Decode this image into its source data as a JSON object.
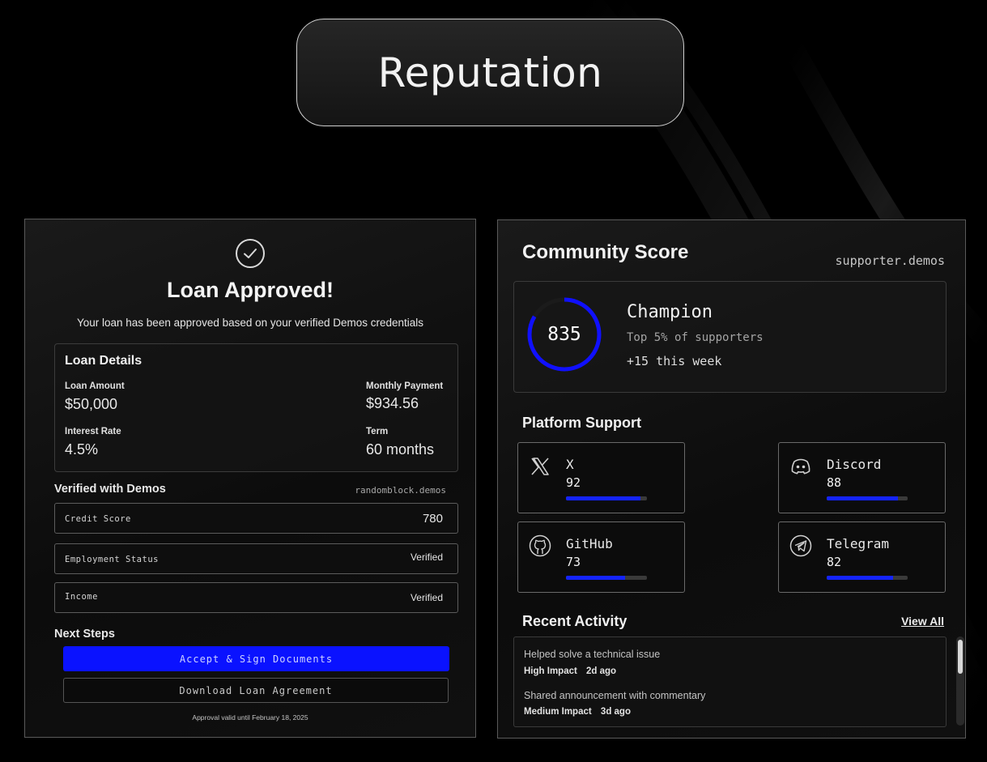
{
  "header": {
    "title": "Reputation"
  },
  "loan": {
    "title": "Loan Approved!",
    "subtitle": "Your loan has been approved based on your verified Demos credentials",
    "details": {
      "title": "Loan Details",
      "amount_label": "Loan Amount",
      "amount_value": "$50,000",
      "monthly_label": "Monthly Payment",
      "monthly_value": "$934.56",
      "rate_label": "Interest Rate",
      "rate_value": "4.5%",
      "term_label": "Term",
      "term_value": "60 months"
    },
    "verified": {
      "title": "Verified with Demos",
      "domain": "randomblock.demos",
      "rows": [
        {
          "label": "Credit Score",
          "value": "780"
        },
        {
          "label": "Employment Status",
          "value": "Verified"
        },
        {
          "label": "Income",
          "value": "Verified"
        }
      ]
    },
    "next_steps": {
      "title": "Next Steps",
      "primary_label": "Accept & Sign Documents",
      "secondary_label": "Download Loan Agreement"
    },
    "validity": "Approval valid until February 18, 2025"
  },
  "community": {
    "title": "Community Score",
    "domain": "supporter.demos",
    "score": {
      "value": "835",
      "ring_fraction": 0.835,
      "tier": "Champion",
      "rank": "Top 5% of supporters",
      "week": "+15 this week"
    },
    "platform_support": {
      "title": "Platform Support",
      "platforms": [
        {
          "name": "X",
          "score": "92",
          "icon": "x-logo-icon"
        },
        {
          "name": "Discord",
          "score": "88",
          "icon": "discord-icon"
        },
        {
          "name": "GitHub",
          "score": "73",
          "icon": "github-icon"
        },
        {
          "name": "Telegram",
          "score": "82",
          "icon": "telegram-icon"
        }
      ]
    },
    "recent_activity": {
      "title": "Recent Activity",
      "view_all": "View All",
      "items": [
        {
          "text": "Helped solve a technical issue",
          "impact": "High Impact",
          "time": "2d ago"
        },
        {
          "text": "Shared announcement with commentary",
          "impact": "Medium Impact",
          "time": "3d ago"
        }
      ]
    }
  },
  "colors": {
    "accent": "#0a12ff",
    "background": "#000000",
    "bar_track": "#3a3a3a"
  }
}
